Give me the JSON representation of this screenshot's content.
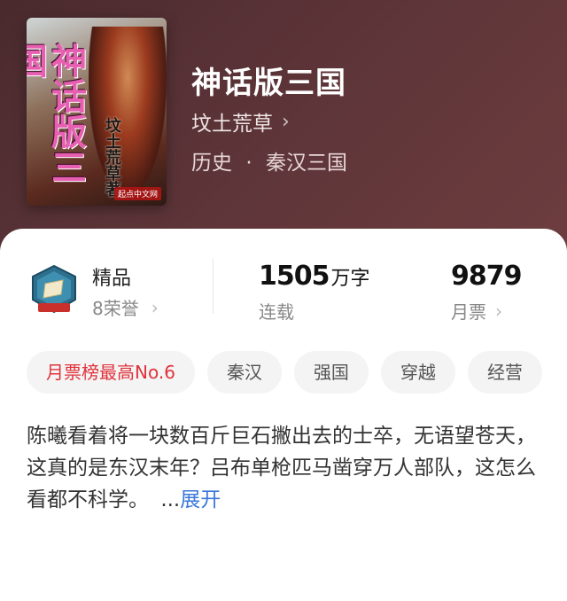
{
  "book": {
    "title": "神话版三国",
    "author": "坟土荒草",
    "category": "历史",
    "subcategory": "秦汉三国",
    "separator": "·"
  },
  "cover": {
    "title_text": "神话版三国",
    "author_text": "坟土荒草著",
    "brand_text": "起点中文网"
  },
  "stats": {
    "honor_label": "精品",
    "honor_count": "8荣誉",
    "word_count_number": "1505",
    "word_count_unit": "万字",
    "status": "连载",
    "monthly_votes": "9879",
    "monthly_votes_label": "月票"
  },
  "tags": [
    {
      "label": "月票榜最高No.6",
      "accent": "#e0333c"
    },
    {
      "label": "秦汉"
    },
    {
      "label": "强国"
    },
    {
      "label": "穿越"
    },
    {
      "label": "经营"
    }
  ],
  "description": {
    "text": "陈曦看着将一块数百斤巨石撇出去的士卒，无语望苍天，这真的是东汉末年？吕布单枪匹马凿穿万人部队，这怎么看都不科学。",
    "ellipsis": "...",
    "expand_label": "展开"
  },
  "icons": {
    "chevron": "chevron-right-icon",
    "badge": "honor-badge-icon"
  },
  "colors": {
    "hero_bg": "#5c3438",
    "link": "#3b78d9",
    "accent_red": "#e0333c"
  }
}
